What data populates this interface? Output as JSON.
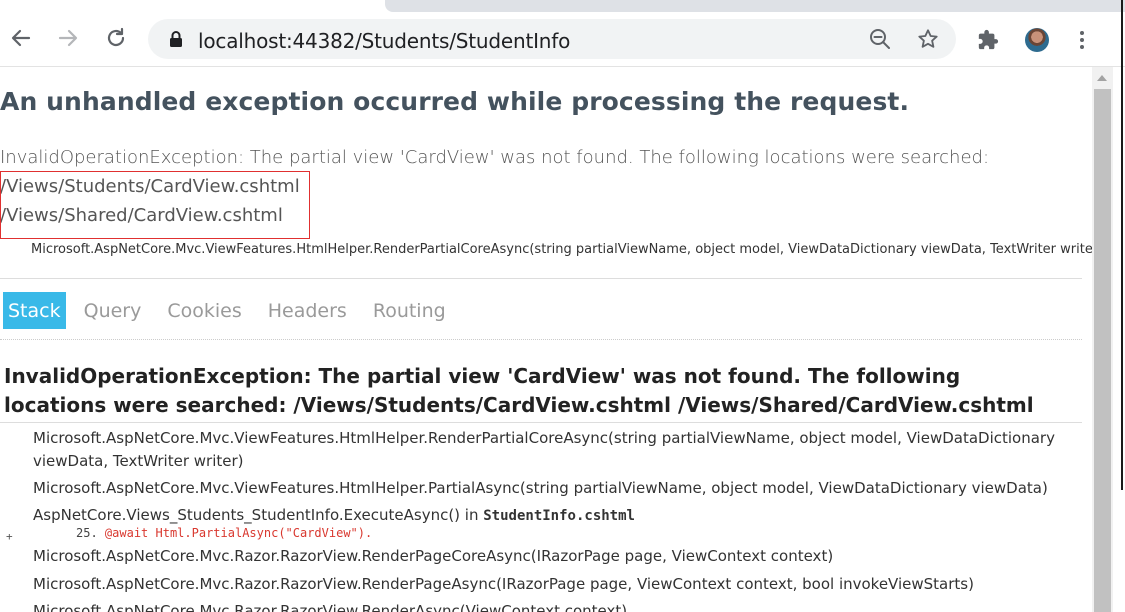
{
  "browser": {
    "url": "localhost:44382/Students/StudentInfo",
    "icons": {
      "back": "arrow-left-icon",
      "forward": "arrow-right-icon",
      "reload": "reload-icon",
      "secure": "lock-icon",
      "zoom": "zoom-out-icon",
      "bookmark": "star-icon",
      "extensions": "puzzle-icon",
      "menu": "kebab-menu-icon"
    }
  },
  "error": {
    "heading": "An unhandled exception occurred while processing the request.",
    "message": "InvalidOperationException: The partial view 'CardView' was not found. The following locations were searched:",
    "locations": [
      "/Views/Students/CardView.cshtml",
      "/Views/Shared/CardView.cshtml"
    ],
    "first_frame": "Microsoft.AspNetCore.Mvc.ViewFeatures.HtmlHelper.RenderPartialCoreAsync(string partialViewName, object model, ViewDataDictionary viewData, TextWriter writer)"
  },
  "tabs": [
    "Stack",
    "Query",
    "Cookies",
    "Headers",
    "Routing"
  ],
  "active_tab": "Stack",
  "stack": {
    "title": "InvalidOperationException: The partial view 'CardView' was not found. The following locations were searched: /Views/Students/CardView.cshtml /Views/Shared/CardView.cshtml",
    "frames": [
      "Microsoft.AspNetCore.Mvc.ViewFeatures.HtmlHelper.RenderPartialCoreAsync(string partialViewName, object model, ViewDataDictionary viewData, TextWriter writer)",
      "Microsoft.AspNetCore.Mvc.ViewFeatures.HtmlHelper.PartialAsync(string partialViewName, object model, ViewDataDictionary viewData)",
      "AspNetCore.Views_Students_StudentInfo.ExecuteAsync() in",
      "Microsoft.AspNetCore.Mvc.Razor.RazorView.RenderPageCoreAsync(IRazorPage page, ViewContext context)",
      "Microsoft.AspNetCore.Mvc.Razor.RazorView.RenderPageAsync(IRazorPage page, ViewContext context, bool invokeViewStarts)",
      "Microsoft.AspNetCore.Mvc.Razor.RazorView.RenderAsync(ViewContext context)"
    ],
    "frame3_file": "StudentInfo.cshtml",
    "code_line_number": "25.",
    "code_line": "@await Html.PartialAsync(\"CardView\").",
    "expander": "+"
  },
  "colors": {
    "active_tab": "#39b9e8",
    "heading": "#44525e",
    "code": "#d9382f",
    "highlight_border": "#e03030"
  }
}
